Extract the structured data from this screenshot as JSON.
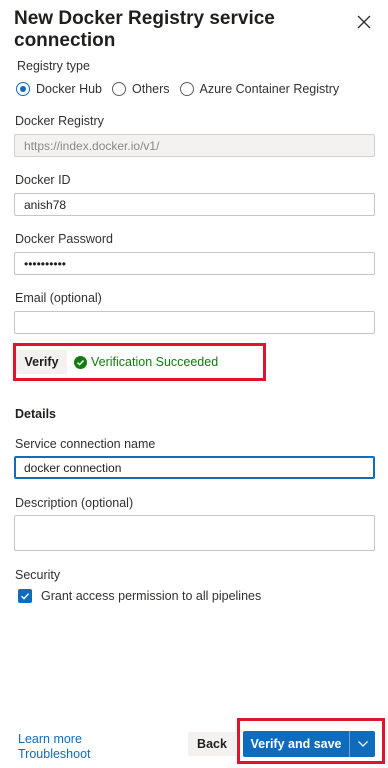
{
  "dialog": {
    "title": "New Docker Registry service connection"
  },
  "registry_type": {
    "label": "Registry type",
    "options": [
      {
        "label": "Docker Hub",
        "selected": true
      },
      {
        "label": "Others",
        "selected": false
      },
      {
        "label": "Azure Container Registry",
        "selected": false
      }
    ]
  },
  "fields": {
    "docker_registry": {
      "label": "Docker Registry",
      "value": "https://index.docker.io/v1/"
    },
    "docker_id": {
      "label": "Docker ID",
      "value": "anish78"
    },
    "docker_password": {
      "label": "Docker Password",
      "value": "••••••••••"
    },
    "email": {
      "label": "Email (optional)",
      "value": ""
    }
  },
  "verify": {
    "button_label": "Verify",
    "status_text": "Verification Succeeded"
  },
  "details": {
    "heading": "Details",
    "service_connection_name": {
      "label": "Service connection name",
      "value": "docker connection"
    },
    "description": {
      "label": "Description (optional)",
      "value": ""
    }
  },
  "security": {
    "label": "Security",
    "grant_access_label": "Grant access permission to all pipelines",
    "grant_access_checked": true
  },
  "footer": {
    "learn_more": "Learn more",
    "troubleshoot": "Troubleshoot",
    "back_label": "Back",
    "verify_save_label": "Verify and save"
  },
  "colors": {
    "accent": "#0f6cbd",
    "success": "#107c10",
    "highlight_border": "#e0142c"
  }
}
